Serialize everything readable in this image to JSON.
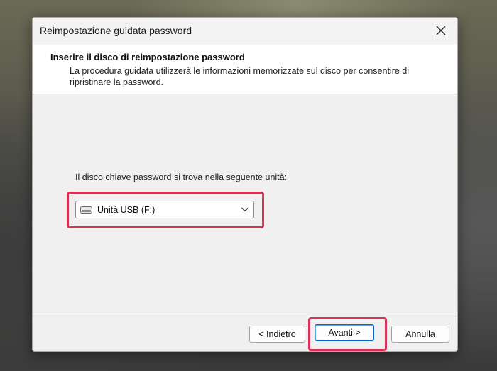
{
  "window": {
    "title": "Reimpostazione guidata password"
  },
  "header": {
    "title": "Inserire il disco di reimpostazione password",
    "description": "La procedura guidata utilizzerà le informazioni memorizzate sul disco per consentire di ripristinare la password."
  },
  "drive_select": {
    "label": "Il disco chiave password si trova nella seguente unità:",
    "selected": "Unità USB (F:)"
  },
  "buttons": {
    "back": "< Indietro",
    "next": "Avanti >",
    "cancel": "Annulla"
  },
  "colors": {
    "highlight": "#d8325a",
    "primary_border": "#0a64c8"
  },
  "icons": [
    "close-icon",
    "usb-drive-icon",
    "chevron-down-icon"
  ]
}
